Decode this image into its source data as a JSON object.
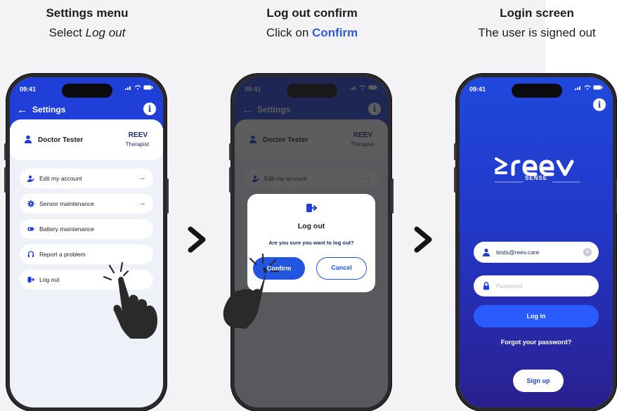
{
  "steps": [
    {
      "title": "Settings menu",
      "subtitle_prefix": "Select ",
      "subtitle_emph": "Log out"
    },
    {
      "title": "Log out confirm",
      "subtitle_prefix": "Click on ",
      "subtitle_emph": "Confirm"
    },
    {
      "title": "Login screen",
      "subtitle": "The user is signed out"
    }
  ],
  "status": {
    "time": "09:41"
  },
  "settings": {
    "header_title": "Settings",
    "profile": {
      "name": "Doctor Tester",
      "brand": "REEV",
      "role": "Therapist"
    },
    "items": [
      {
        "label": "Edit my account",
        "icon": "user-edit-icon",
        "arrow": true
      },
      {
        "label": "Sensor maintenance",
        "icon": "gear-icon",
        "arrow": true
      },
      {
        "label": "Battery maintenance",
        "icon": "battery-icon",
        "arrow": false
      },
      {
        "label": "Report a problem",
        "icon": "headset-icon",
        "arrow": false
      },
      {
        "label": "Log out",
        "icon": "logout-icon",
        "arrow": false
      }
    ]
  },
  "dialog": {
    "title": "Log out",
    "question": "Are you sure you want to log out?",
    "confirm_label": "Confirm",
    "cancel_label": "Cancel"
  },
  "login": {
    "brand_sub": "SENSE",
    "email_value": "tests@reev.care",
    "password_placeholder": "Password",
    "login_label": "Log in",
    "forgot_label": "Forgot your password?",
    "signup_label": "Sign up"
  },
  "colors": {
    "primary": "#1f3fd8",
    "accent": "#2255e0",
    "background": "#f3f3f5"
  }
}
